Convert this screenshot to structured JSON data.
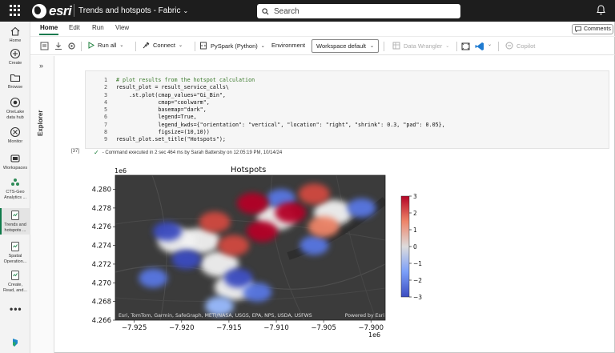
{
  "topbar": {
    "brand": "esri",
    "workspace_title": "Trends and hotspots - Fabric",
    "search_placeholder": "Search"
  },
  "rail": {
    "items": [
      {
        "label": "Home",
        "icon": "home-icon"
      },
      {
        "label": "Create",
        "icon": "create-icon"
      },
      {
        "label": "Browse",
        "icon": "folder-icon"
      },
      {
        "label": "OneLake data hub",
        "icon": "onelake-icon"
      },
      {
        "label": "Monitor",
        "icon": "monitor-icon"
      },
      {
        "label": "Workspaces",
        "icon": "workspaces-icon"
      },
      {
        "label": "CTS-Geo Analytics ...",
        "icon": "workspace-icon"
      },
      {
        "label": "Trends and hotspots ...",
        "icon": "notebook-icon",
        "active": true
      },
      {
        "label": "Spatial Operation...",
        "icon": "notebook-icon"
      },
      {
        "label": "Create, Read, and...",
        "icon": "notebook-icon"
      }
    ],
    "more": "•••"
  },
  "menu": {
    "tabs": [
      "Home",
      "Edit",
      "Run",
      "View"
    ],
    "comments": "Comments"
  },
  "toolbar": {
    "run_all": "Run all",
    "connect": "Connect",
    "language": "PySpark (Python)",
    "environment": "Environment",
    "workspace_default": "Workspace default",
    "data_wrangler": "Data Wrangler",
    "copilot": "Copilot"
  },
  "explorer": {
    "label": "Explorer"
  },
  "cell": {
    "lines": [
      {
        "n": "1",
        "text": "# plot results from the hotspot calculation"
      },
      {
        "n": "2",
        "text": "result_plot = result_service_calls\\"
      },
      {
        "n": "3",
        "text": "    .st.plot(cmap_values=\"Gi_Bin\","
      },
      {
        "n": "4",
        "text": "             cmap=\"coolwarm\","
      },
      {
        "n": "5",
        "text": "             basemap=\"dark\","
      },
      {
        "n": "6",
        "text": "             legend=True,"
      },
      {
        "n": "7",
        "text": "             legend_kwds={\"orientation\": \"vertical\", \"location\": \"right\", \"shrink\": 0.3, \"pad\": 0.05},"
      },
      {
        "n": "8",
        "text": "             figsize=(10,10))"
      },
      {
        "n": "9",
        "text": "result_plot.set_title(\"Hotspots\");"
      }
    ],
    "exec_count": "[37]",
    "exec_status": "- Command executed in 2 sec 464 ms by Sarah Battersby on 12:05:19 PM, 10/14/24"
  },
  "chart_data": {
    "type": "heatmap",
    "title": "Hotspots",
    "x_offset_label": "1e6",
    "y_offset_label": "1e6",
    "x_ticks": [
      "−7.925",
      "−7.920",
      "−7.915",
      "−7.910",
      "−7.905",
      "−7.900"
    ],
    "y_ticks": [
      "4.280",
      "4.278",
      "4.276",
      "4.274",
      "4.272",
      "4.270",
      "4.268",
      "4.266"
    ],
    "xlim": [
      -7.927,
      -7.8985
    ],
    "ylim": [
      4.266,
      4.2815
    ],
    "colorbar": {
      "cmap": "coolwarm",
      "min": -3,
      "max": 3,
      "ticks": [
        "3",
        "2",
        "1",
        "0",
        "−1",
        "−2",
        "−3"
      ]
    },
    "basemap": "dark",
    "attribution_left": "Esri, TomTom, Garmin, SafeGraph, METI/NASA, USGS, EPA, NPS, USDA, USFWS",
    "attribution_right": "Powered by Esri",
    "hot_regions": [
      {
        "x": -7.9125,
        "y": 4.2785,
        "value": 3
      },
      {
        "x": -7.9085,
        "y": 4.2775,
        "value": 3
      },
      {
        "x": -7.9115,
        "y": 4.2755,
        "value": 3
      },
      {
        "x": -7.9145,
        "y": 4.274,
        "value": 2
      },
      {
        "x": -7.9165,
        "y": 4.2765,
        "value": 2
      },
      {
        "x": -7.906,
        "y": 4.2795,
        "value": 2
      },
      {
        "x": -7.905,
        "y": 4.276,
        "value": 1
      }
    ],
    "cold_regions": [
      {
        "x": -7.9215,
        "y": 4.2755,
        "value": -3
      },
      {
        "x": -7.9195,
        "y": 4.2725,
        "value": -3
      },
      {
        "x": -7.914,
        "y": 4.2705,
        "value": -3
      },
      {
        "x": -7.923,
        "y": 4.2705,
        "value": -2
      },
      {
        "x": -7.912,
        "y": 4.269,
        "value": -2
      },
      {
        "x": -7.9095,
        "y": 4.279,
        "value": -2
      },
      {
        "x": -7.901,
        "y": 4.278,
        "value": -2
      },
      {
        "x": -7.906,
        "y": 4.274,
        "value": -2
      },
      {
        "x": -7.916,
        "y": 4.2675,
        "value": -1
      }
    ],
    "neutral_regions": [
      {
        "x": -7.918,
        "y": 4.2745,
        "value": 0
      },
      {
        "x": -7.916,
        "y": 4.272,
        "value": 0
      },
      {
        "x": -7.9205,
        "y": 4.2745,
        "value": 0
      },
      {
        "x": -7.9145,
        "y": 4.2695,
        "value": 0
      },
      {
        "x": -7.904,
        "y": 4.2775,
        "value": 0
      },
      {
        "x": -7.91,
        "y": 4.277,
        "value": 0
      }
    ]
  }
}
